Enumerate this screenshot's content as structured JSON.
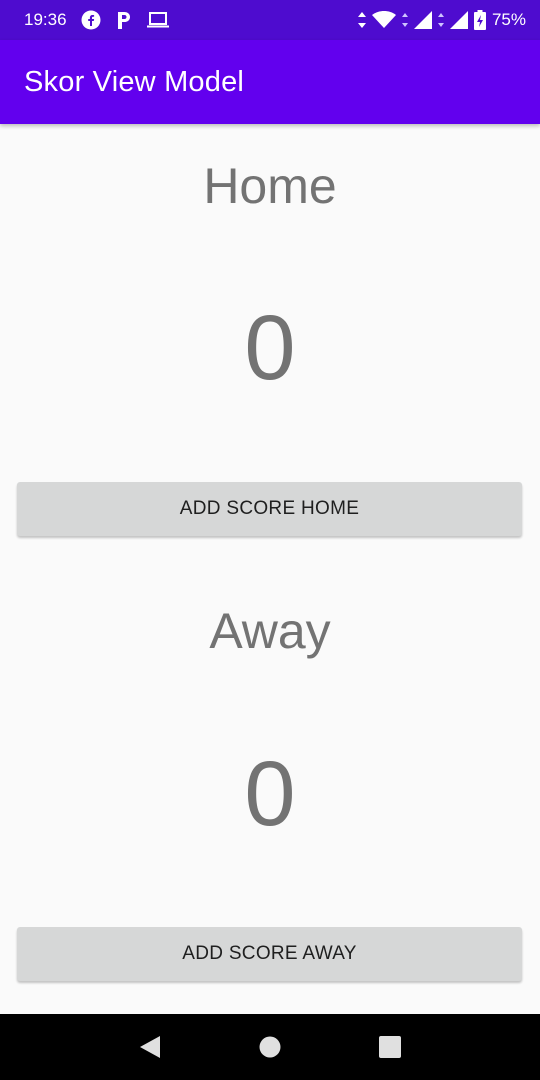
{
  "status_bar": {
    "time": "19:36",
    "battery_percent": "75%",
    "icons_left": [
      "facebook-icon",
      "p-app-icon",
      "laptop-icon"
    ],
    "icons_right": [
      "data-arrows-icon",
      "wifi-icon",
      "signal-icon",
      "signal-icon",
      "battery-charging-icon"
    ]
  },
  "app_bar": {
    "title": "Skor View Model"
  },
  "home": {
    "label": "Home",
    "score": "0",
    "button_label": "ADD SCORE HOME"
  },
  "away": {
    "label": "Away",
    "score": "0",
    "button_label": "ADD SCORE AWAY"
  },
  "nav_bar": {
    "buttons": [
      "back-icon",
      "home-icon",
      "recents-icon"
    ]
  },
  "colors": {
    "status_bar": "#4e0ccf",
    "app_bar": "#6200ee",
    "background": "#fafafa",
    "button": "#d6d7d7",
    "text_gray": "#737373"
  }
}
